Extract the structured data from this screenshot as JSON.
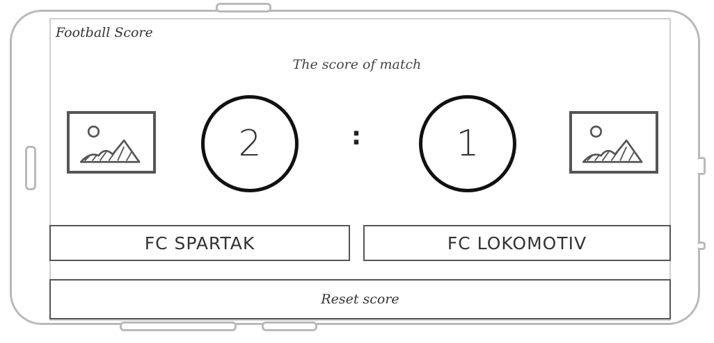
{
  "app": {
    "title": "Football Score"
  },
  "match": {
    "subtitle": "The score of match",
    "separator": ":",
    "home": {
      "score": "2",
      "team_label": "FC SPARTAK",
      "logo_icon": "image-placeholder-icon"
    },
    "away": {
      "score": "1",
      "team_label": "FC LOKOMOTIV",
      "logo_icon": "image-placeholder-icon"
    }
  },
  "actions": {
    "reset_label": "Reset score"
  },
  "colors": {
    "stroke": "#555555",
    "circle": "#111111",
    "frame": "#b9b9b9"
  }
}
